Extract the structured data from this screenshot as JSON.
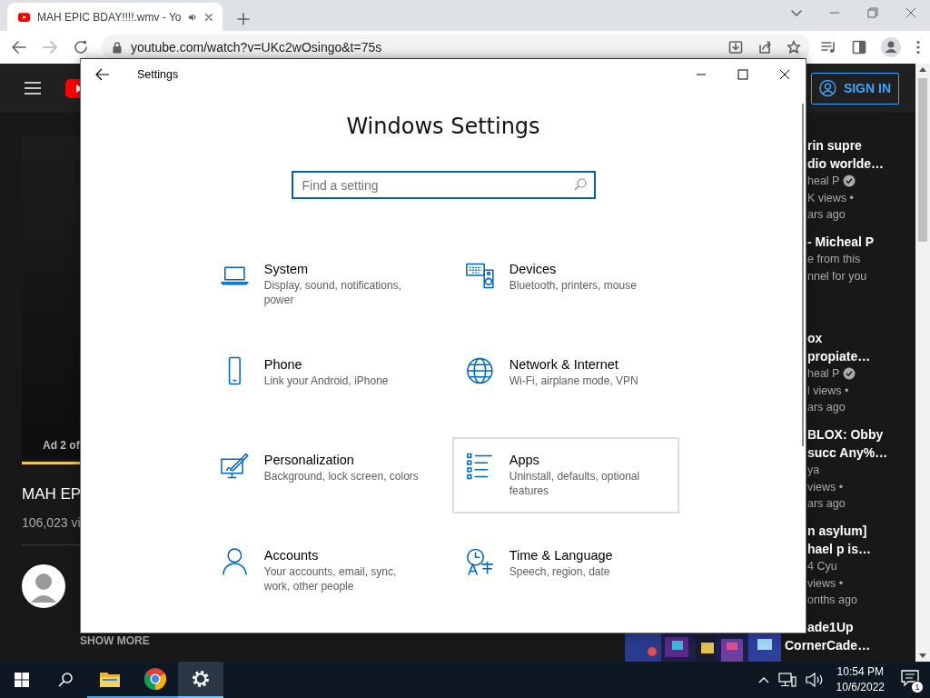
{
  "browser": {
    "tab": {
      "title": "MAH EPIC BDAY!!!!.wmv - Yo",
      "audio_playing": true
    },
    "forward_disabled": true,
    "url": "youtube.com/watch?v=UKc2wOsingo&t=75s"
  },
  "youtube": {
    "sign_in": "SIGN IN",
    "ad_label": "Ad 2 of",
    "video_title": "MAH EP",
    "views": "106,023 vi",
    "show_more": "SHOW MORE",
    "related": [
      {
        "title": [
          "rin supre",
          "dio worlde…"
        ],
        "channel": "heal P",
        "verified": true,
        "meta": [
          "K views •",
          "ars ago"
        ]
      },
      {
        "title": [
          "- Micheal P"
        ],
        "meta": [
          "e from this",
          "nnel for you"
        ]
      },
      {
        "title": [
          "ox",
          "propiate…"
        ],
        "channel": "heal P",
        "verified": true,
        "meta": [
          "l views •",
          "ars ago"
        ]
      },
      {
        "title": [
          "BLOX: Obby",
          "succ Any%…"
        ],
        "channel": "ya",
        "verified": false,
        "meta": [
          "views •",
          "ars ago"
        ]
      },
      {
        "title": [
          "n asylum]",
          "hael p is…"
        ],
        "channel": "4 Cyu",
        "verified": false,
        "meta": [
          "views •",
          "onths ago"
        ]
      },
      {
        "title": [
          "ade1Up",
          "CornerCade…"
        ],
        "thumbnail": {
          "kind": "picture"
        }
      }
    ]
  },
  "settings": {
    "title": "Settings",
    "heading": "Windows Settings",
    "search": {
      "placeholder": "Find a setting"
    },
    "items": [
      {
        "kind": "system",
        "name": "System",
        "description": "Display, sound, notifications, power",
        "highlighted": false
      },
      {
        "kind": "devices",
        "name": "Devices",
        "description": "Bluetooth, printers, mouse",
        "highlighted": false
      },
      {
        "kind": "phone",
        "name": "Phone",
        "description": "Link your Android, iPhone",
        "highlighted": false
      },
      {
        "kind": "network",
        "name": "Network & Internet",
        "description": "Wi-Fi, airplane mode, VPN",
        "highlighted": false
      },
      {
        "kind": "personalization",
        "name": "Personalization",
        "description": "Background, lock screen, colors",
        "highlighted": false
      },
      {
        "kind": "apps",
        "name": "Apps",
        "description": "Uninstall, defaults, optional features",
        "highlighted": true
      },
      {
        "kind": "accounts",
        "name": "Accounts",
        "description": "Your accounts, email, sync, work, other people",
        "highlighted": false
      },
      {
        "kind": "time",
        "name": "Time & Language",
        "description": "Speech, region, date",
        "highlighted": false
      }
    ]
  },
  "taskbar": {
    "buttons": [
      {
        "kind": "start"
      },
      {
        "kind": "search"
      }
    ],
    "apps": [
      {
        "kind": "explorer",
        "running": true,
        "selected": false
      },
      {
        "kind": "chrome",
        "running": true,
        "selected": false
      },
      {
        "kind": "settings",
        "running": true,
        "selected": true
      }
    ],
    "time": "10:54 PM",
    "date": "10/6/2022",
    "notification_count": "1"
  }
}
